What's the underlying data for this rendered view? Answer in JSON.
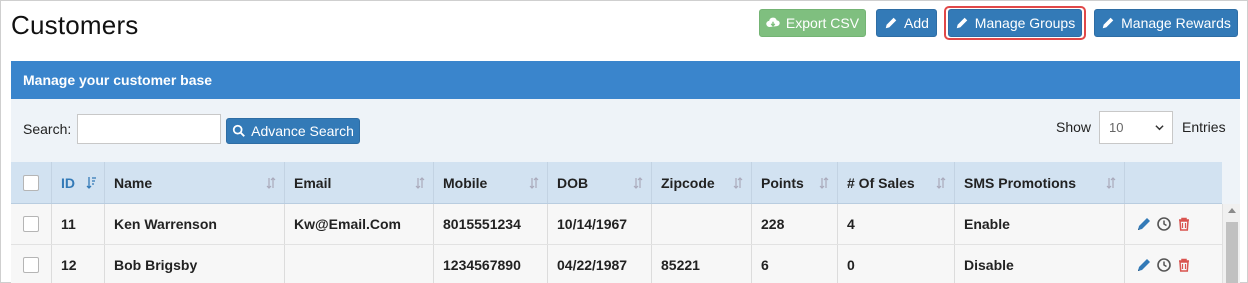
{
  "page": {
    "title": "Customers"
  },
  "toolbar": {
    "export_label": "Export CSV",
    "add_label": "Add",
    "groups_label": "Manage Groups",
    "rewards_label": "Manage Rewards"
  },
  "panel": {
    "title": "Manage your customer base"
  },
  "search": {
    "label": "Search:",
    "value": "",
    "placeholder": "",
    "advance_label": "Advance Search"
  },
  "pagination": {
    "show_label": "Show",
    "page_size": "10",
    "entries_label": "Entries"
  },
  "table": {
    "columns": [
      "ID",
      "Name",
      "Email",
      "Mobile",
      "DOB",
      "Zipcode",
      "Points",
      "# Of Sales",
      "SMS Promotions"
    ],
    "rows": [
      {
        "id": "11",
        "name": "Ken Warrenson",
        "email": "Kw@Email.Com",
        "mobile": "8015551234",
        "dob": "10/14/1967",
        "zipcode": "",
        "points": "228",
        "sales": "4",
        "sms": "Enable"
      },
      {
        "id": "12",
        "name": "Bob Brigsby",
        "email": "",
        "mobile": "1234567890",
        "dob": "04/22/1987",
        "zipcode": "85221",
        "points": "6",
        "sales": "0",
        "sms": "Disable"
      }
    ]
  },
  "colors": {
    "primary": "#337ab7",
    "export": "#7fbf7f",
    "panel_header": "#3a85cc",
    "delete": "#d9534f",
    "highlight": "#e04848"
  },
  "icons": [
    "cloud-download-icon",
    "pencil-icon",
    "search-icon",
    "sort-icon",
    "sort-asc-icon",
    "edit-icon",
    "history-icon",
    "trash-icon",
    "chevron-down-icon"
  ]
}
